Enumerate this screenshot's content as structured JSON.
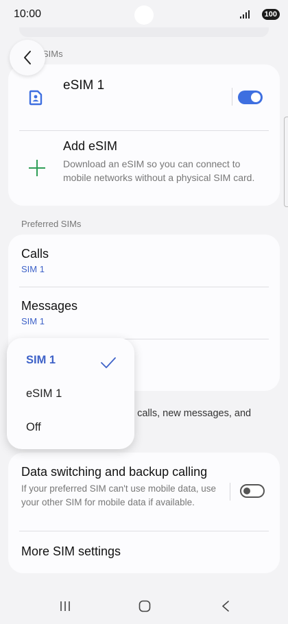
{
  "status": {
    "time": "10:00",
    "battery": "100"
  },
  "section_sims_label": "SIMs",
  "esim1": {
    "title": "eSIM 1",
    "enabled": true
  },
  "add_esim": {
    "title": "Add eSIM",
    "description": "Download an eSIM so you can connect to mobile networks without a physical SIM card."
  },
  "preferred": {
    "section_label": "Preferred SIMs",
    "rows": [
      {
        "title": "Calls",
        "value": "SIM 1"
      },
      {
        "title": "Messages",
        "value": "SIM 1"
      }
    ]
  },
  "footnote": "g calls, new messages, and",
  "dropdown": {
    "options": [
      {
        "label": "SIM 1",
        "selected": true
      },
      {
        "label": "eSIM 1",
        "selected": false
      },
      {
        "label": "Off",
        "selected": false
      }
    ]
  },
  "data_switching": {
    "title": "Data switching and backup calling",
    "description": "If your preferred SIM can't use mobile data, use your other SIM for mobile data if available.",
    "enabled": false
  },
  "more_settings": {
    "title": "More SIM settings"
  },
  "colors": {
    "accent": "#3e6fe0",
    "accent_text": "#3e62c8",
    "plus": "#2e9e57",
    "background": "#f3f3f5"
  }
}
